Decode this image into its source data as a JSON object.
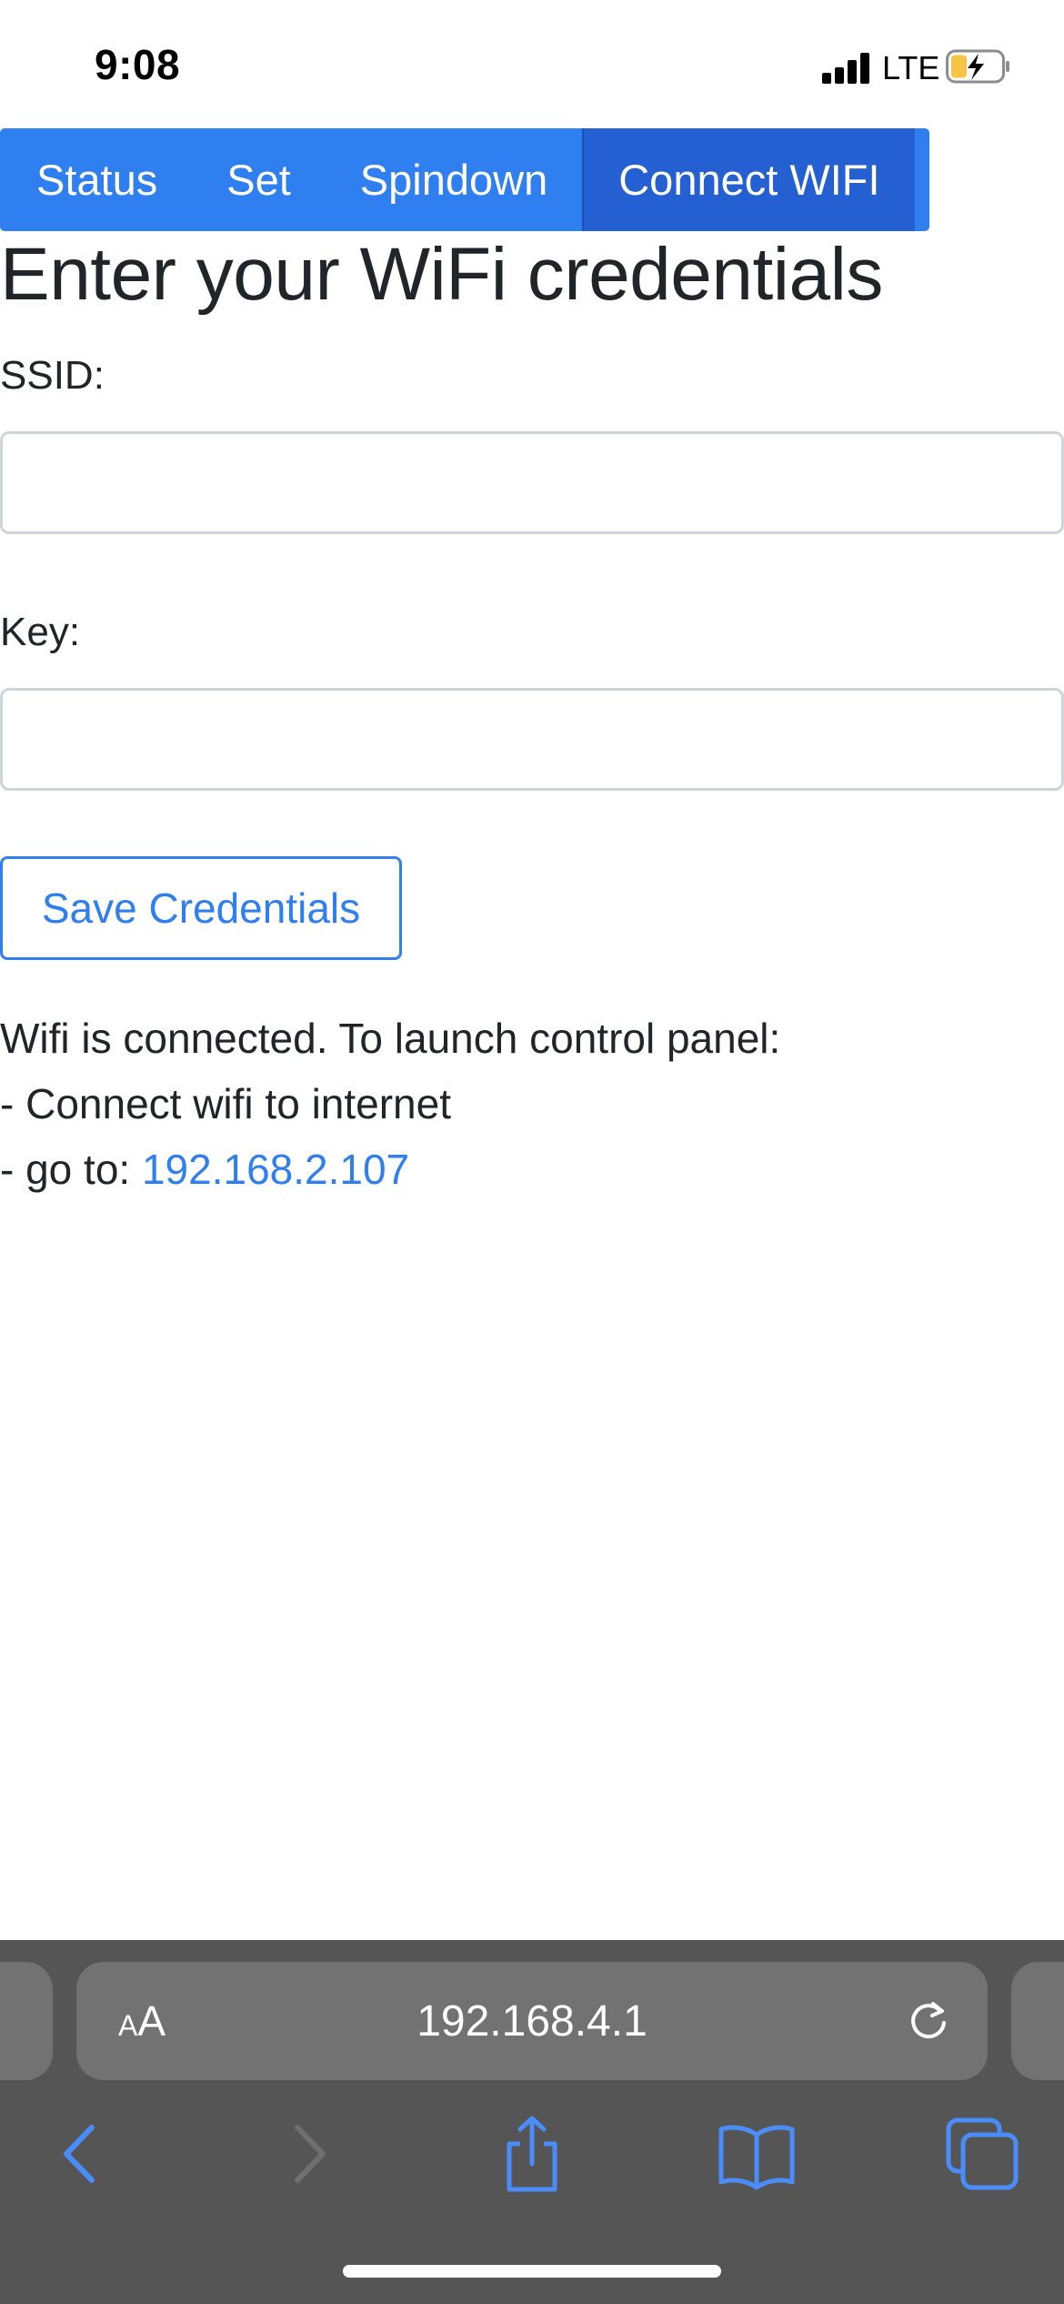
{
  "status_bar": {
    "time": "9:08",
    "network": "LTE"
  },
  "nav": {
    "tabs": [
      {
        "label": "Status"
      },
      {
        "label": "Set"
      },
      {
        "label": "Spindown"
      },
      {
        "label": "Connect WIFI",
        "active": true
      }
    ]
  },
  "page": {
    "title": "Enter your WiFi credentials",
    "ssid_label": "SSID:",
    "ssid_value": "",
    "key_label": "Key:",
    "key_value": "",
    "save_button": "Save Credentials",
    "info_line1": "Wifi is connected. To launch control panel:",
    "info_line2": "- Connect wifi to internet",
    "info_line3_prefix": "- go to: ",
    "info_link": "192.168.2.107"
  },
  "browser": {
    "text_size_label_small": "A",
    "text_size_label_large": "A",
    "url": "192.168.4.1"
  },
  "colors": {
    "accent": "#2f7ff0",
    "active_tab": "#2460d1",
    "toolbar": "#555555",
    "toolbar_icon": "#4a8dfa"
  },
  "icons": [
    "signal-icon",
    "battery-charging-icon",
    "reload-icon",
    "back-icon",
    "forward-icon",
    "share-icon",
    "bookmarks-icon",
    "tabs-icon"
  ]
}
